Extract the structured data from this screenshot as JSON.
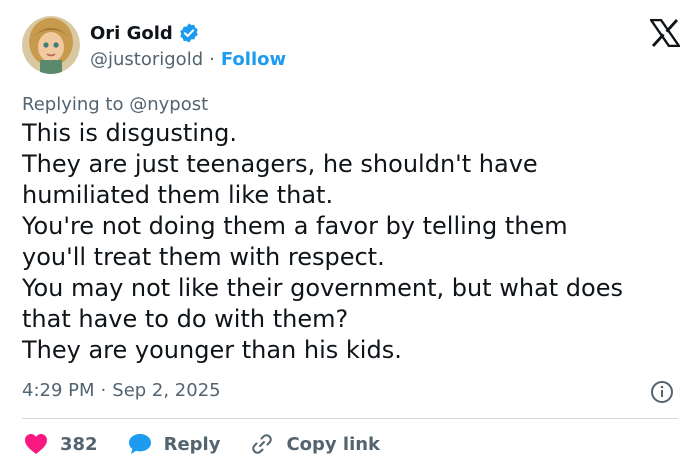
{
  "author": {
    "name": "Ori Gold",
    "handle": "@justorigold",
    "follow_label": "Follow",
    "separator": "·",
    "verified_icon": "verified-badge-icon",
    "verified_color": "#1d9bf0"
  },
  "brand_icon": "x-logo-icon",
  "replying": {
    "prefix": "Replying to",
    "mention": "@nypost"
  },
  "tweet_lines": [
    "This is disgusting.",
    "They are just teenagers, he shouldn't have",
    "humiliated them like that.",
    "You're not doing them a favor by telling them",
    "you'll treat them with respect.",
    "You may not like their government, but what does",
    "that have to do with them?",
    "They are younger than his kids."
  ],
  "meta": {
    "time": "4:29 PM",
    "separator": "·",
    "date": "Sep 2, 2025"
  },
  "actions": {
    "like_count": "382",
    "reply_label": "Reply",
    "copy_link_label": "Copy link"
  },
  "colors": {
    "accent": "#1d9bf0",
    "like": "#f91880",
    "secondary_text": "#536471",
    "primary_text": "#0f1419",
    "divider": "#cfd9de"
  }
}
